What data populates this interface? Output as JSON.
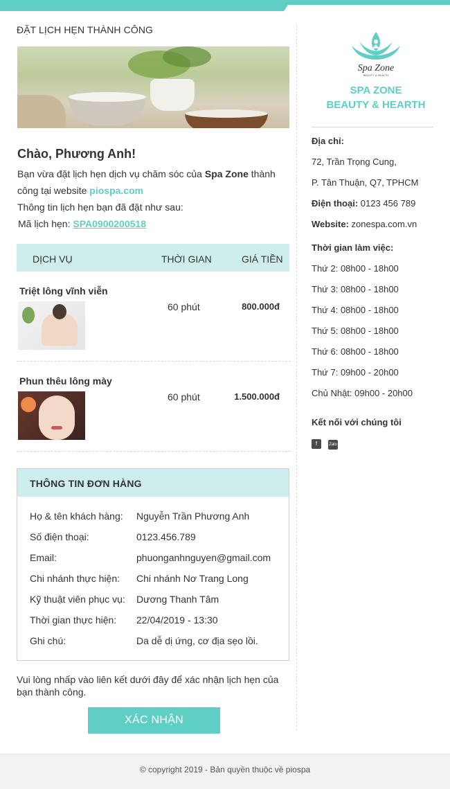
{
  "heading": "ĐẶT LỊCH HẸN THÀNH CÔNG",
  "greeting": "Chào, Phương Anh!",
  "intro": {
    "text1": "Bạn vừa đặt lịch hẹn dịch vụ chăm sóc của ",
    "brand_name": "Spa Zone",
    "text2": " thành công tại website ",
    "website": "piospa.com",
    "line2": "Thông tin lịch hẹn bạn đã đặt như sau:",
    "code_label": "Mã lịch hẹn: ",
    "code": "SPA0900200518"
  },
  "services": {
    "headers": {
      "service": "DỊCH VỤ",
      "time": "THỜI GIAN",
      "price": "GIÁ TIỀN"
    },
    "items": [
      {
        "name": "Triệt lông vĩnh viễn",
        "time": "60 phút",
        "price": "800.000đ"
      },
      {
        "name": "Phun thêu lông mày",
        "time": "60 phút",
        "price": "1.500.000đ"
      }
    ]
  },
  "order": {
    "title": "THÔNG TIN ĐƠN HÀNG",
    "rows": [
      {
        "label": "Họ & tên khách hàng:",
        "value": "Nguyễn Trần Phương Anh"
      },
      {
        "label": "Số điện thoại:",
        "value": "0123.456.789"
      },
      {
        "label": "Email:",
        "value": "phuonganhnguyen@gmail.com"
      },
      {
        "label": "Chi nhánh thực hiện:",
        "value": "Chi nhánh Nơ Trang Long"
      },
      {
        "label": "Kỹ thuật viên phục vụ:",
        "value": "Dương Thanh Tâm"
      },
      {
        "label": "Thời gian thực hiện:",
        "value": "22/04/2019 - 13:30"
      },
      {
        "label": "Ghi chú:",
        "value": "Da dễ dị ứng, cơ địa sẹo lồi."
      }
    ]
  },
  "note": "Vui lòng nhấp vào liên kết dưới đây để xác nhận lịch hẹn của bạn thành công.",
  "confirm_label": "XÁC NHẬN",
  "sidebar": {
    "logo_text": "Spa Zone",
    "logo_sub": "BEAUTY & HEALTH",
    "brand_line1": "SPA ZONE",
    "brand_line2": "BEAUTY & HEARTH",
    "address_label": "Địa chỉ:",
    "address_line1": "72, Trần Trọng Cung,",
    "address_line2": "P. Tân Thuận, Q7, TPHCM",
    "phone_label": "Điện thoại:",
    "phone": " 0123 456 789",
    "website_label": "Website:",
    "website": " zonespa.com.vn",
    "hours_title": "Thời gian làm việc:",
    "hours": [
      "Thứ 2: 08h00 - 18h00",
      "Thứ 3: 08h00 - 18h00",
      "Thứ 4: 08h00 - 18h00",
      "Thứ 5: 08h00 - 18h00",
      "Thứ 6: 08h00 - 18h00",
      "Thứ 7: 09h00 - 20h00",
      "Chủ Nhật: 09h00 - 20h00"
    ],
    "connect_title": "Kết nối với chúng tôi",
    "social_facebook": "f",
    "social_zalo": "Zalo"
  },
  "footer": "© copyright 2019 - Bản quyền thuộc về piospa",
  "colors": {
    "accent": "#5fcec4",
    "header_bg": "#cdeeec"
  }
}
